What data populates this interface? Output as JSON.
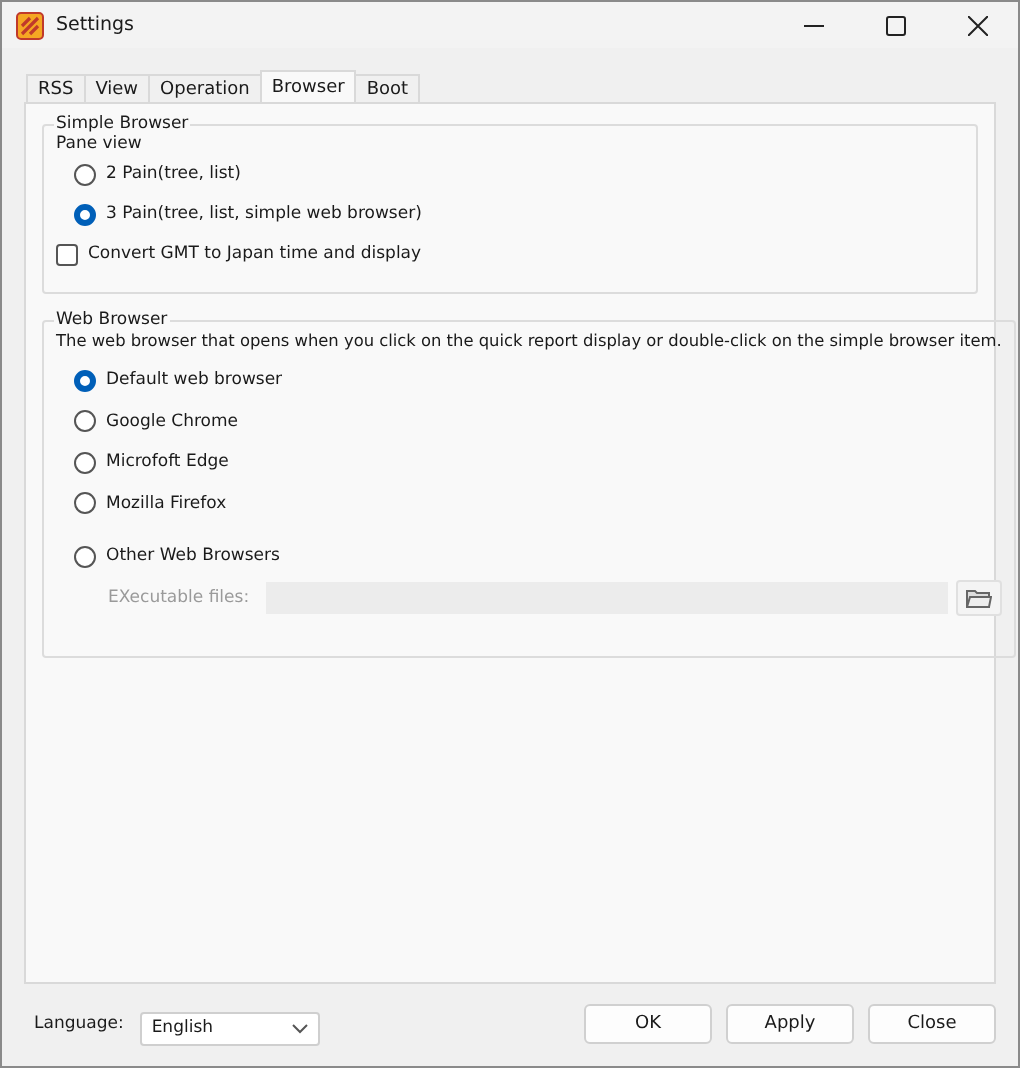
{
  "window": {
    "title": "Settings"
  },
  "tabs": [
    {
      "label": "RSS",
      "selected": false
    },
    {
      "label": "View",
      "selected": false
    },
    {
      "label": "Operation",
      "selected": false
    },
    {
      "label": "Browser",
      "selected": true
    },
    {
      "label": "Boot",
      "selected": false
    }
  ],
  "simple_browser": {
    "title": "Simple Browser",
    "pane_view_label": "Pane view",
    "pane_options": [
      {
        "label": "2 Pain(tree, list)",
        "selected": false
      },
      {
        "label": "3 Pain(tree, list, simple web browser)",
        "selected": true
      }
    ],
    "convert_gmt": {
      "label": "Convert GMT to Japan time and display",
      "checked": false
    }
  },
  "web_browser": {
    "title": "Web Browser",
    "description": "The web browser that opens when you click on the quick report display or double-click on the simple browser item.",
    "options": [
      {
        "label": "Default web browser",
        "selected": true
      },
      {
        "label": "Google Chrome",
        "selected": false
      },
      {
        "label": "Microfoft Edge",
        "selected": false
      },
      {
        "label": "Mozilla Firefox",
        "selected": false
      },
      {
        "label": "Other Web Browsers",
        "selected": false
      }
    ],
    "executable": {
      "label": "EXecutable files:",
      "disabled": true
    }
  },
  "language": {
    "label": "Language:",
    "value": "English"
  },
  "buttons": [
    "OK",
    "Apply",
    "Close"
  ]
}
